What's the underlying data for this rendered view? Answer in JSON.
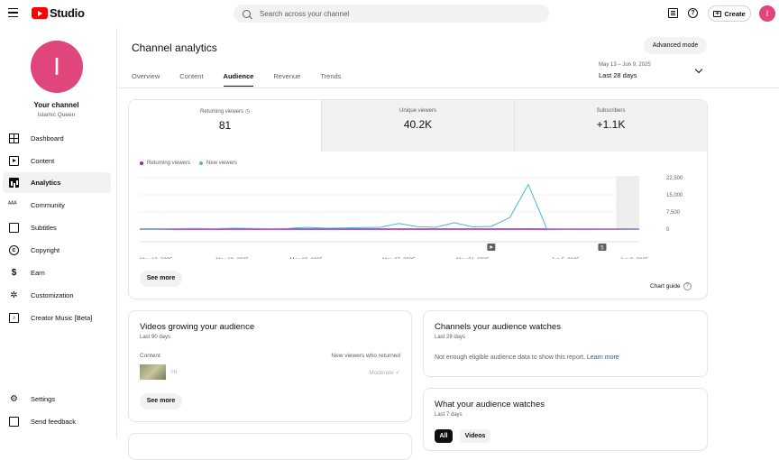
{
  "header": {
    "logo_text": "Studio",
    "search_placeholder": "Search across your channel",
    "create_label": "Create",
    "avatar_letter": "I"
  },
  "sidebar": {
    "avatar_letter": "I",
    "title": "Your channel",
    "channel_name": "Islamic Queen",
    "items": [
      {
        "label": "Dashboard",
        "icon": "dashboard-icon"
      },
      {
        "label": "Content",
        "icon": "content-icon"
      },
      {
        "label": "Analytics",
        "icon": "analytics-icon"
      },
      {
        "label": "Community",
        "icon": "community-icon"
      },
      {
        "label": "Subtitles",
        "icon": "subtitles-icon"
      },
      {
        "label": "Copyright",
        "icon": "copyright-icon"
      },
      {
        "label": "Earn",
        "icon": "earn-icon"
      },
      {
        "label": "Customization",
        "icon": "customization-icon"
      },
      {
        "label": "Creator Music [Beta]",
        "icon": "music-icon"
      }
    ],
    "bottom_items": [
      {
        "label": "Settings",
        "icon": "gear-icon"
      },
      {
        "label": "Send feedback",
        "icon": "feedback-icon"
      }
    ]
  },
  "main": {
    "title": "Channel analytics",
    "advanced_mode": "Advanced mode",
    "tabs": [
      "Overview",
      "Content",
      "Audience",
      "Revenue",
      "Trends"
    ],
    "active_tab": "Audience",
    "date_range": {
      "sub": "May 13 – Jun 9, 2025",
      "main": "Last 28 days"
    }
  },
  "metrics": [
    {
      "label": "Returning viewers",
      "value": "81"
    },
    {
      "label": "Unique viewers",
      "value": "40.2K"
    },
    {
      "label": "Subscribers",
      "value": "+1.1K"
    }
  ],
  "chart_data": {
    "type": "line",
    "x": [
      "May 13",
      "May 14",
      "May 15",
      "May 16",
      "May 17",
      "May 18",
      "May 19",
      "May 20",
      "May 21",
      "May 22",
      "May 23",
      "May 24",
      "May 25",
      "May 26",
      "May 27",
      "May 28",
      "May 29",
      "May 30",
      "May 31",
      "Jun 1",
      "Jun 2",
      "Jun 3",
      "Jun 4",
      "Jun 5",
      "Jun 6",
      "Jun 7",
      "Jun 8",
      "Jun 9"
    ],
    "tick_labels": [
      "May 13, 2025",
      "May 18, 2025",
      "May 22, 2025",
      "May 27, 2025",
      "May 31, 2025",
      "Jun 5, 2025",
      "Jun 9, 2025"
    ],
    "tick_index": [
      0,
      5,
      9,
      14,
      18,
      23,
      27
    ],
    "series": [
      {
        "name": "Returning viewers",
        "color": "#9c27b0",
        "values": [
          3,
          3,
          3,
          3,
          3,
          3,
          3,
          3,
          3,
          3,
          3,
          3,
          3,
          3,
          3,
          3,
          3,
          3,
          3,
          3,
          3,
          3,
          3,
          3,
          3,
          3,
          3,
          3
        ]
      },
      {
        "name": "New viewers",
        "color": "#4fb3d9",
        "values": [
          0,
          0,
          200,
          300,
          200,
          400,
          300,
          200,
          300,
          800,
          400,
          500,
          700,
          800,
          2500,
          1100,
          800,
          2800,
          1000,
          1200,
          5000,
          19500,
          200,
          100,
          150,
          100,
          100,
          0
        ]
      }
    ],
    "yticks": [
      "22,500",
      "15,000",
      "7,500",
      "0"
    ],
    "ytick_values": [
      22500,
      15000,
      7500,
      0
    ],
    "ylim": [
      0,
      22500
    ],
    "markers": [
      {
        "index": 19,
        "symbol": "play"
      },
      {
        "index": 25,
        "symbol": "5"
      }
    ],
    "shaded_from_index": 26
  },
  "legend": [
    "Returning viewers",
    "New viewers"
  ],
  "chart_card": {
    "see_more": "See more",
    "chart_guide": "Chart guide"
  },
  "growing": {
    "title": "Videos growing your audience",
    "sub": "Last 90 days",
    "col_content": "Content",
    "col_metric": "New viewers who returned",
    "row_title": "Hi",
    "row_value": "Moderate",
    "see_more": "See more"
  },
  "channels": {
    "title": "Channels your audience watches",
    "sub": "Last 28 days",
    "message": "Not enough eligible audience data to show this report.",
    "learn_more": "Learn more"
  },
  "watches": {
    "title": "What your audience watches",
    "sub": "Last 7 days",
    "filters": [
      "All",
      "Videos"
    ]
  }
}
